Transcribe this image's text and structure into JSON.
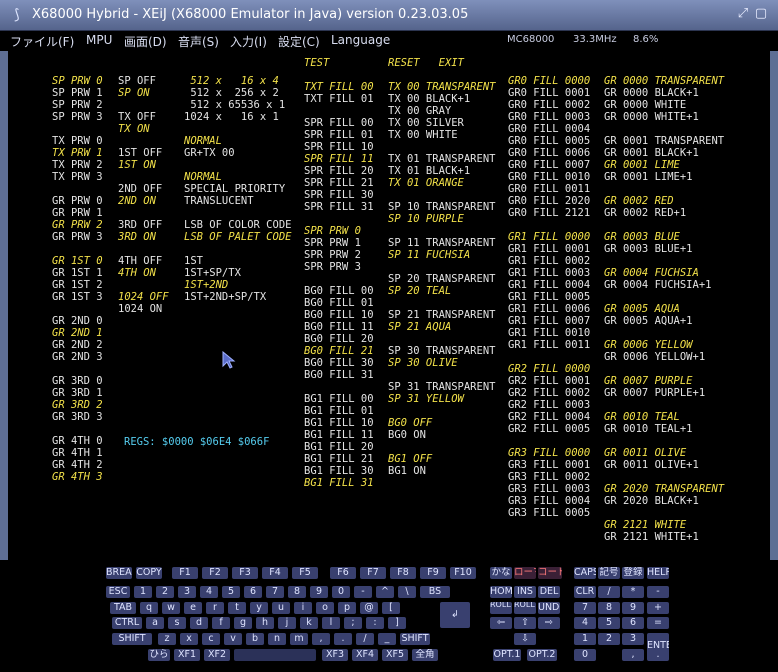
{
  "window": {
    "title": "X68000 Hybrid - XEiJ (X68000 Emulator in Java) version 0.23.03.05",
    "app_icon": "x68000-logo-icon",
    "buttons": [
      {
        "name": "restore",
        "icon": "restore-icon",
        "glyph": "⤢"
      },
      {
        "name": "minimize",
        "icon": "minimize-icon",
        "glyph": "▢"
      },
      {
        "name": "close",
        "icon": "close-icon",
        "glyph": "✕"
      }
    ]
  },
  "menu": {
    "items": [
      "ファイル(F)",
      "MPU",
      "画面(D)",
      "音声(S)",
      "入力(I)",
      "設定(C)",
      "Language"
    ],
    "status": {
      "model": "MC68000",
      "clock": "33.3MHz",
      "load": "8.6%"
    }
  },
  "screen": {
    "columns": [
      {
        "id": "c1",
        "rows": [
          {
            "t": "SP PRW 0",
            "y": 1
          },
          {
            "t": "SP PRW 1"
          },
          {
            "t": "SP PRW 2"
          },
          {
            "t": "SP PRW 3"
          },
          {
            "t": ""
          },
          {
            "t": "TX PRW 0"
          },
          {
            "t": "TX PRW 1",
            "y": 1
          },
          {
            "t": "TX PRW 2"
          },
          {
            "t": "TX PRW 3"
          },
          {
            "t": ""
          },
          {
            "t": "GR PRW 0"
          },
          {
            "t": "GR PRW 1"
          },
          {
            "t": "GR PRW 2",
            "y": 1
          },
          {
            "t": "GR PRW 3"
          },
          {
            "t": ""
          },
          {
            "t": "GR 1ST 0",
            "y": 1
          },
          {
            "t": "GR 1ST 1"
          },
          {
            "t": "GR 1ST 2"
          },
          {
            "t": "GR 1ST 3"
          },
          {
            "t": ""
          },
          {
            "t": "GR 2ND 0"
          },
          {
            "t": "GR 2ND 1",
            "y": 1
          },
          {
            "t": "GR 2ND 2"
          },
          {
            "t": "GR 2ND 3"
          },
          {
            "t": ""
          },
          {
            "t": "GR 3RD 0"
          },
          {
            "t": "GR 3RD 1"
          },
          {
            "t": "GR 3RD 2",
            "y": 1
          },
          {
            "t": "GR 3RD 3"
          },
          {
            "t": ""
          },
          {
            "t": "GR 4TH 0"
          },
          {
            "t": "GR 4TH 1"
          },
          {
            "t": "GR 4TH 2"
          },
          {
            "t": "GR 4TH 3",
            "y": 1
          }
        ]
      },
      {
        "id": "c2",
        "rows": [
          {
            "t": "SP OFF"
          },
          {
            "t": "SP ON",
            "y": 1
          },
          {
            "t": ""
          },
          {
            "t": "TX OFF"
          },
          {
            "t": "TX ON",
            "y": 1
          },
          {
            "t": ""
          },
          {
            "t": "1ST OFF"
          },
          {
            "t": "1ST ON",
            "y": 1
          },
          {
            "t": ""
          },
          {
            "t": "2ND OFF"
          },
          {
            "t": "2ND ON",
            "y": 1
          },
          {
            "t": ""
          },
          {
            "t": "3RD OFF"
          },
          {
            "t": "3RD ON",
            "y": 1
          },
          {
            "t": ""
          },
          {
            "t": "4TH OFF"
          },
          {
            "t": "4TH ON",
            "y": 1
          },
          {
            "t": ""
          },
          {
            "t": "1024 OFF",
            "y": 1
          },
          {
            "t": "1024 ON"
          }
        ]
      },
      {
        "id": "c3",
        "rows": [
          {
            "t": " 512 x   16 x 4",
            "y": 1
          },
          {
            "t": " 512 x  256 x 2"
          },
          {
            "t": " 512 x 65536 x 1"
          },
          {
            "t": "1024 x   16 x 1"
          },
          {
            "t": ""
          },
          {
            "t": "NORMAL",
            "y": 1
          },
          {
            "t": "GR+TX 00"
          },
          {
            "t": ""
          },
          {
            "t": "NORMAL",
            "y": 1
          },
          {
            "t": "SPECIAL PRIORITY"
          },
          {
            "t": "TRANSLUCENT"
          },
          {
            "t": ""
          },
          {
            "t": "LSB OF COLOR CODE"
          },
          {
            "t": "LSB OF PALET CODE",
            "y": 1
          },
          {
            "t": ""
          },
          {
            "t": "1ST"
          },
          {
            "t": "1ST+SP/TX"
          },
          {
            "t": "1ST+2ND",
            "y": 1
          },
          {
            "t": "1ST+2ND+SP/TX"
          }
        ]
      },
      {
        "id": "c4",
        "rows": [
          {
            "t": "TEST",
            "y": 1
          },
          {
            "t": ""
          },
          {
            "t": "TXT FILL 00",
            "y": 1
          },
          {
            "t": "TXT FILL 01"
          },
          {
            "t": ""
          },
          {
            "t": "SPR FILL 00"
          },
          {
            "t": "SPR FILL 01"
          },
          {
            "t": "SPR FILL 10"
          },
          {
            "t": "SPR FILL 11",
            "y": 1
          },
          {
            "t": "SPR FILL 20"
          },
          {
            "t": "SPR FILL 21"
          },
          {
            "t": "SPR FILL 30"
          },
          {
            "t": "SPR FILL 31"
          },
          {
            "t": ""
          },
          {
            "t": "SPR PRW 0",
            "y": 1
          },
          {
            "t": "SPR PRW 1"
          },
          {
            "t": "SPR PRW 2"
          },
          {
            "t": "SPR PRW 3"
          },
          {
            "t": ""
          },
          {
            "t": "BG0 FILL 00"
          },
          {
            "t": "BG0 FILL 01"
          },
          {
            "t": "BG0 FILL 10"
          },
          {
            "t": "BG0 FILL 11"
          },
          {
            "t": "BG0 FILL 20"
          },
          {
            "t": "BG0 FILL 21",
            "y": 1
          },
          {
            "t": "BG0 FILL 30"
          },
          {
            "t": "BG0 FILL 31"
          },
          {
            "t": ""
          },
          {
            "t": "BG1 FILL 00"
          },
          {
            "t": "BG1 FILL 01"
          },
          {
            "t": "BG1 FILL 10"
          },
          {
            "t": "BG1 FILL 11"
          },
          {
            "t": "BG1 FILL 20"
          },
          {
            "t": "BG1 FILL 21"
          },
          {
            "t": "BG1 FILL 30"
          },
          {
            "t": "BG1 FILL 31",
            "y": 1
          }
        ]
      },
      {
        "id": "c5",
        "rows": [
          {
            "t": "RESET   EXIT",
            "y": 1
          },
          {
            "t": ""
          },
          {
            "t": "TX 00 TRANSPARENT",
            "y": 1
          },
          {
            "t": "TX 00 BLACK+1"
          },
          {
            "t": "TX 00 GRAY"
          },
          {
            "t": "TX 00 SILVER"
          },
          {
            "t": "TX 00 WHITE"
          },
          {
            "t": ""
          },
          {
            "t": "TX 01 TRANSPARENT"
          },
          {
            "t": "TX 01 BLACK+1"
          },
          {
            "t": "TX 01 ORANGE",
            "y": 1
          },
          {
            "t": ""
          },
          {
            "t": "SP 10 TRANSPARENT"
          },
          {
            "t": "SP 10 PURPLE",
            "y": 1
          },
          {
            "t": ""
          },
          {
            "t": "SP 11 TRANSPARENT"
          },
          {
            "t": "SP 11 FUCHSIA",
            "y": 1
          },
          {
            "t": ""
          },
          {
            "t": "SP 20 TRANSPARENT"
          },
          {
            "t": "SP 20 TEAL",
            "y": 1
          },
          {
            "t": ""
          },
          {
            "t": "SP 21 TRANSPARENT"
          },
          {
            "t": "SP 21 AQUA",
            "y": 1
          },
          {
            "t": ""
          },
          {
            "t": "SP 30 TRANSPARENT"
          },
          {
            "t": "SP 30 OLIVE",
            "y": 1
          },
          {
            "t": ""
          },
          {
            "t": "SP 31 TRANSPARENT"
          },
          {
            "t": "SP 31 YELLOW",
            "y": 1
          },
          {
            "t": ""
          },
          {
            "t": "BG0 OFF",
            "y": 1
          },
          {
            "t": "BG0 ON"
          },
          {
            "t": ""
          },
          {
            "t": "BG1 OFF",
            "y": 1
          },
          {
            "t": "BG1 ON"
          }
        ]
      },
      {
        "id": "c6",
        "rows": [
          {
            "t": "GR0 FILL 0000",
            "y": 1
          },
          {
            "t": "GR0 FILL 0001"
          },
          {
            "t": "GR0 FILL 0002"
          },
          {
            "t": "GR0 FILL 0003"
          },
          {
            "t": "GR0 FILL 0004"
          },
          {
            "t": "GR0 FILL 0005"
          },
          {
            "t": "GR0 FILL 0006"
          },
          {
            "t": "GR0 FILL 0007"
          },
          {
            "t": "GR0 FILL 0010"
          },
          {
            "t": "GR0 FILL 0011"
          },
          {
            "t": "GR0 FILL 2020"
          },
          {
            "t": "GR0 FILL 2121"
          },
          {
            "t": ""
          },
          {
            "t": "GR1 FILL 0000",
            "y": 1
          },
          {
            "t": "GR1 FILL 0001"
          },
          {
            "t": "GR1 FILL 0002"
          },
          {
            "t": "GR1 FILL 0003"
          },
          {
            "t": "GR1 FILL 0004"
          },
          {
            "t": "GR1 FILL 0005"
          },
          {
            "t": "GR1 FILL 0006"
          },
          {
            "t": "GR1 FILL 0007"
          },
          {
            "t": "GR1 FILL 0010"
          },
          {
            "t": "GR1 FILL 0011"
          },
          {
            "t": ""
          },
          {
            "t": "GR2 FILL 0000",
            "y": 1
          },
          {
            "t": "GR2 FILL 0001"
          },
          {
            "t": "GR2 FILL 0002"
          },
          {
            "t": "GR2 FILL 0003"
          },
          {
            "t": "GR2 FILL 0004"
          },
          {
            "t": "GR2 FILL 0005"
          },
          {
            "t": ""
          },
          {
            "t": "GR3 FILL 0000",
            "y": 1
          },
          {
            "t": "GR3 FILL 0001"
          },
          {
            "t": "GR3 FILL 0002"
          },
          {
            "t": "GR3 FILL 0003"
          },
          {
            "t": "GR3 FILL 0004"
          },
          {
            "t": "GR3 FILL 0005"
          }
        ]
      },
      {
        "id": "c7",
        "rows": [
          {
            "t": "GR 0000 TRANSPARENT",
            "y": 1
          },
          {
            "t": "GR 0000 BLACK+1"
          },
          {
            "t": "GR 0000 WHITE"
          },
          {
            "t": "GR 0000 WHITE+1"
          },
          {
            "t": ""
          },
          {
            "t": "GR 0001 TRANSPARENT"
          },
          {
            "t": "GR 0001 BLACK+1"
          },
          {
            "t": "GR 0001 LIME",
            "y": 1
          },
          {
            "t": "GR 0001 LIME+1"
          },
          {
            "t": ""
          },
          {
            "t": "GR 0002 RED",
            "y": 1
          },
          {
            "t": "GR 0002 RED+1"
          },
          {
            "t": ""
          },
          {
            "t": "GR 0003 BLUE",
            "y": 1
          },
          {
            "t": "GR 0003 BLUE+1"
          },
          {
            "t": ""
          },
          {
            "t": "GR 0004 FUCHSIA",
            "y": 1
          },
          {
            "t": "GR 0004 FUCHSIA+1"
          },
          {
            "t": ""
          },
          {
            "t": "GR 0005 AQUA",
            "y": 1
          },
          {
            "t": "GR 0005 AQUA+1"
          },
          {
            "t": ""
          },
          {
            "t": "GR 0006 YELLOW",
            "y": 1
          },
          {
            "t": "GR 0006 YELLOW+1"
          },
          {
            "t": ""
          },
          {
            "t": "GR 0007 PURPLE",
            "y": 1
          },
          {
            "t": "GR 0007 PURPLE+1"
          },
          {
            "t": ""
          },
          {
            "t": "GR 0010 TEAL",
            "y": 1
          },
          {
            "t": "GR 0010 TEAL+1"
          },
          {
            "t": ""
          },
          {
            "t": "GR 0011 OLIVE",
            "y": 1
          },
          {
            "t": "GR 0011 OLIVE+1"
          },
          {
            "t": ""
          },
          {
            "t": "GR 2020 TRANSPARENT",
            "y": 1
          },
          {
            "t": "GR 2020 BLACK+1"
          },
          {
            "t": ""
          },
          {
            "t": "GR 2121 WHITE",
            "y": 1
          },
          {
            "t": "GR 2121 WHITE+1"
          }
        ]
      }
    ],
    "regs": "REGS: $0000 $06E4 $066F",
    "colors": {
      "highlight": "#f2e14a",
      "normal": "#e4e4e4",
      "regs": "#55ccee"
    },
    "cursor_icon": "mouse-pointer-icon"
  },
  "keyboard": {
    "rows": [
      [
        "BREAK",
        "COPY",
        "F1",
        "F2",
        "F3",
        "F4",
        "F5",
        "F6",
        "F7",
        "F8",
        "F9",
        "F10",
        "かな",
        "ローマ",
        "コード",
        "CAPS",
        "記号",
        "登録",
        "HELP"
      ],
      [
        "ESC",
        "1",
        "2",
        "3",
        "4",
        "5",
        "6",
        "7",
        "8",
        "9",
        "0",
        "-",
        "^",
        "\\",
        "BS",
        "HOME",
        "INS",
        "DEL",
        "CLR",
        "/",
        "*",
        "-"
      ],
      [
        "TAB",
        "q",
        "w",
        "e",
        "r",
        "t",
        "y",
        "u",
        "i",
        "o",
        "p",
        "@",
        "[",
        "↲",
        "ROLL UP",
        "ROLL DOWN",
        "UNDO",
        "7",
        "8",
        "9",
        "+"
      ],
      [
        "CTRL",
        "a",
        "s",
        "d",
        "f",
        "g",
        "h",
        "j",
        "k",
        "l",
        ";",
        ":",
        "]",
        "⇦",
        "⇧",
        "⇨",
        "4",
        "5",
        "6",
        "="
      ],
      [
        "SHIFT",
        "z",
        "x",
        "c",
        "v",
        "b",
        "n",
        "m",
        ",",
        ".",
        "/",
        "_",
        "SHIFT",
        "⇩",
        "1",
        "2",
        "3",
        "ENTER"
      ],
      [
        "ひら",
        "XF1",
        "XF2",
        "XF3",
        "XF4",
        "XF5",
        "全角",
        "OPT.1",
        "OPT.2",
        "0",
        ",",
        "."
      ]
    ],
    "red_keys": [
      "ローマ",
      "コード"
    ]
  }
}
